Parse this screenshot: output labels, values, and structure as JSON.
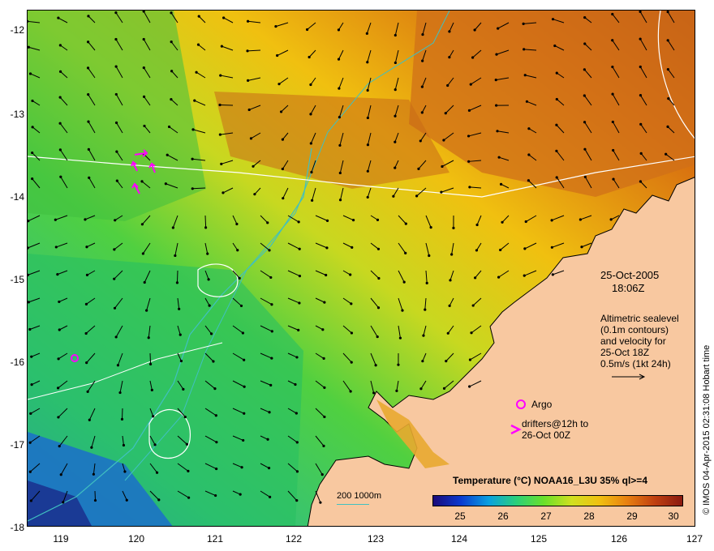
{
  "map": {
    "lon_ticks": [
      "119",
      "120",
      "121",
      "122",
      "123",
      "124",
      "125",
      "126",
      "127"
    ],
    "lat_ticks": [
      "-12",
      "-13",
      "-14",
      "-15",
      "-16",
      "-17",
      "-18"
    ],
    "colors": {
      "land": "#f8c8a0",
      "contour": "#ffffff",
      "bathymetry": "#40c0c0",
      "marker": "#ff00ff",
      "arrow": "#000000"
    }
  },
  "annotations": {
    "date": "25-Oct-2005",
    "time": "18:06Z",
    "altimetry_lines": [
      "Altimetric sealevel",
      "(0.1m contours)",
      "and velocity for",
      "25-Oct 18Z",
      "0.5m/s (1kt 24h)"
    ],
    "argo_label": "Argo",
    "drifters_lines": [
      "drifters@12h to",
      "26-Oct 00Z"
    ],
    "depth_label": "200  1000m"
  },
  "legend": {
    "title": "Temperature (°C) NOAA16_L3U 35% ql>=4",
    "ticks": [
      "25",
      "26",
      "27",
      "28",
      "29",
      "30"
    ]
  },
  "credit": "© IMOS 04-Apr-2015 02:31:08 Hobart time"
}
